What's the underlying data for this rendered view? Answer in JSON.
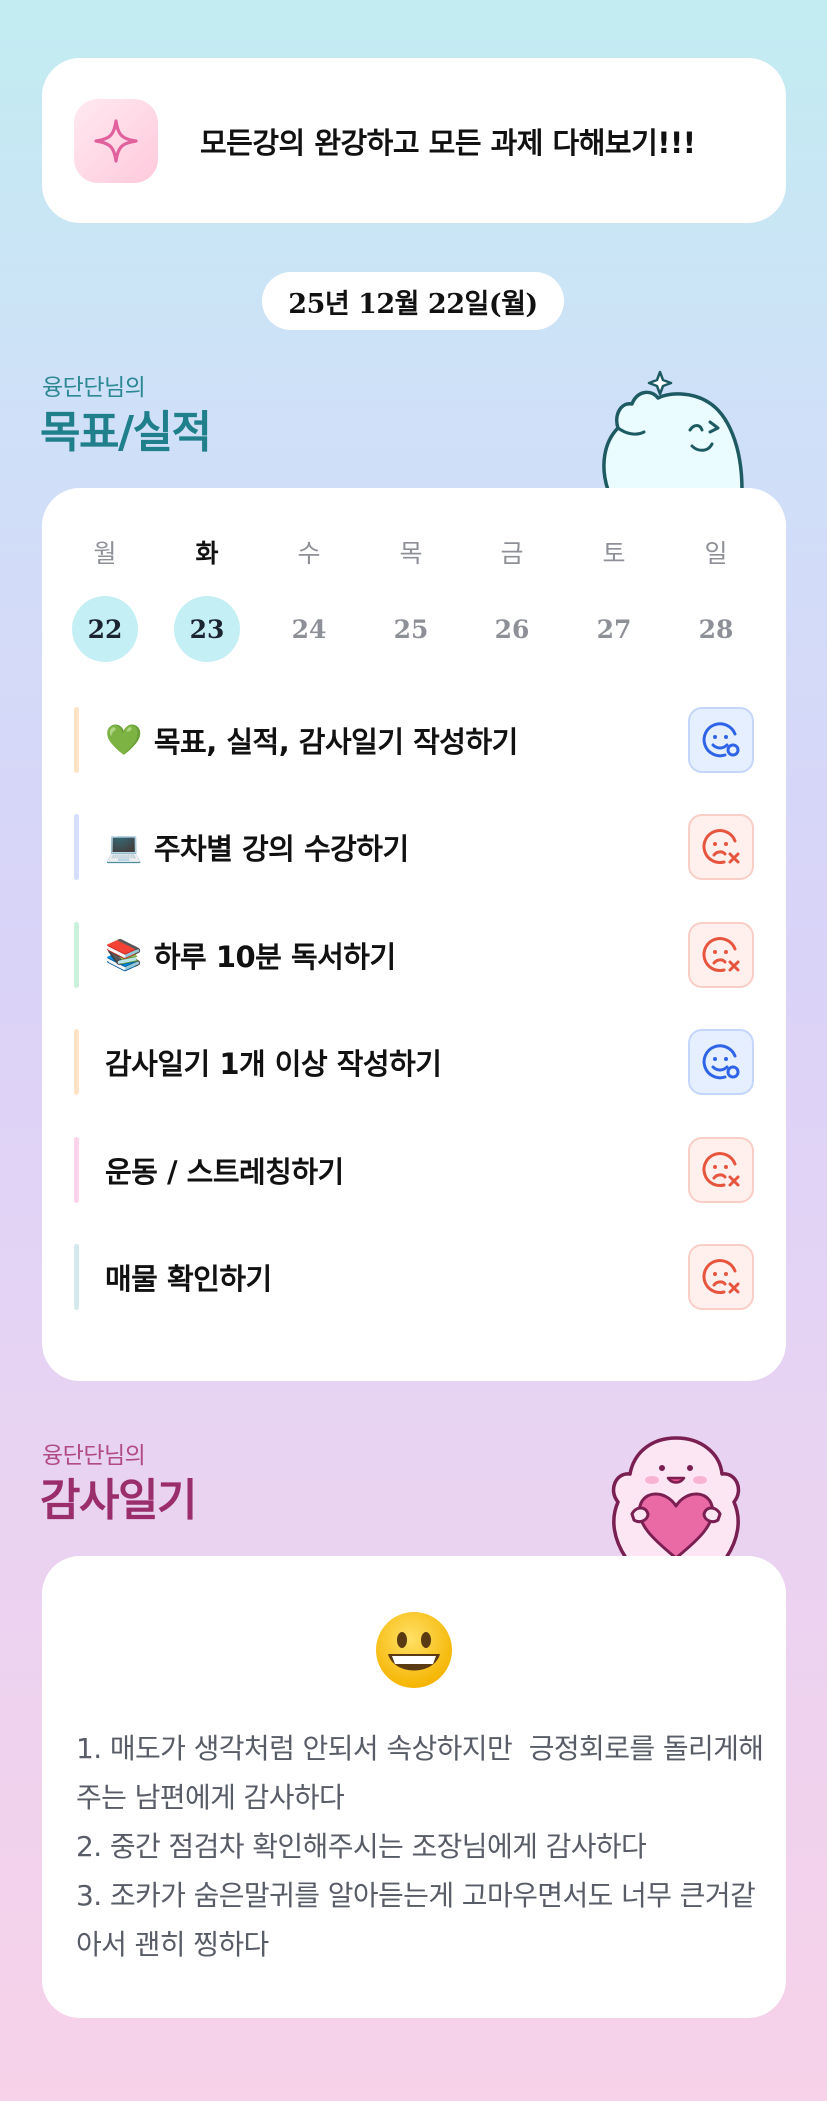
{
  "goal": {
    "icon": "sparkle-icon",
    "text": "모든강의 완강하고 모든 과제 다해보기!!!"
  },
  "date": "25년 12월 22일(월)",
  "goals_section": {
    "subtitle": "융단단님의",
    "title": "목표/실적"
  },
  "week": {
    "days": [
      "월",
      "화",
      "수",
      "목",
      "금",
      "토",
      "일"
    ],
    "dates": [
      "22",
      "23",
      "24",
      "25",
      "26",
      "27",
      "28"
    ],
    "active_day": "화",
    "completed_dates": [
      "22",
      "23"
    ]
  },
  "tasks": [
    {
      "emoji": "💚",
      "label": "목표, 실적, 감사일기 작성하기",
      "status": "done",
      "accent": "#ffe3c4"
    },
    {
      "emoji": "💻",
      "label": "주차별 강의 수강하기",
      "status": "not-done",
      "accent": "#d6deff"
    },
    {
      "emoji": "📚",
      "label": "하루 10분 독서하기",
      "status": "not-done",
      "accent": "#c9f1dc"
    },
    {
      "emoji": "",
      "label": "감사일기 1개 이상 작성하기",
      "status": "done",
      "accent": "#ffe3c4"
    },
    {
      "emoji": "",
      "label": "운동 / 스트레칭하기",
      "status": "not-done",
      "accent": "#ffd3ec"
    },
    {
      "emoji": "",
      "label": "매물 확인하기",
      "status": "not-done",
      "accent": "#d3e9ec"
    }
  ],
  "gratitude_section": {
    "subtitle": "융단단님의",
    "title": "감사일기"
  },
  "diary": {
    "mood_emoji": "😀",
    "lines": [
      "1. 매도가 생각처럼 안되서 속상하지만  긍정회로를 돌리게해주는 남편에게 감사하다",
      "2. 중간 점검차 확인해주시는 조장님에게 감사하다",
      "3. 조카가 숨은말귀를 알아듣는게 고마우면서도 너무 큰거같아서 괜히 찡하다"
    ]
  },
  "colors": {
    "done_icon": "#2f64e8",
    "not_done_icon": "#e8553e",
    "teal_heading": "#1f7f8a",
    "pink_heading": "#9a2e6c"
  }
}
